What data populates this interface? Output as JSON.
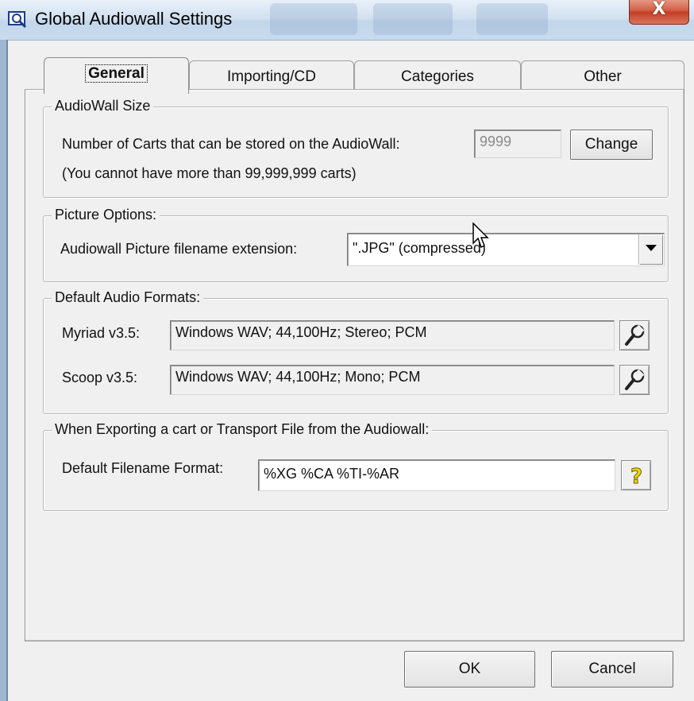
{
  "window": {
    "title": "Global Audiowall Settings",
    "close_glyph": "X"
  },
  "tabs": [
    {
      "label": "General",
      "active": true
    },
    {
      "label": "Importing/CD",
      "active": false
    },
    {
      "label": "Categories",
      "active": false
    },
    {
      "label": "Other",
      "active": false
    }
  ],
  "audiowall_size": {
    "legend": "AudioWall Size",
    "label": "Number of Carts that can be stored on the AudioWall:",
    "value": "9999",
    "change_button": "Change",
    "note": "(You cannot have more than 99,999,999 carts)"
  },
  "picture_options": {
    "legend": "Picture Options:",
    "label": "Audiowall Picture filename extension:",
    "selected": "\".JPG\" (compressed)"
  },
  "audio_formats": {
    "legend": "Default Audio Formats:",
    "myriad_label": "Myriad v3.5:",
    "myriad_value": "Windows WAV; 44,100Hz; Stereo; PCM",
    "scoop_label": "Scoop v3.5:",
    "scoop_value": "Windows WAV; 44,100Hz; Mono; PCM"
  },
  "export": {
    "legend": "When Exporting a cart or Transport File from the Audiowall:",
    "label": "Default Filename Format:",
    "value": "%XG %CA %TI-%AR",
    "help_glyph": "?"
  },
  "footer": {
    "ok": "OK",
    "cancel": "Cancel"
  },
  "icons": {
    "app": "audiowall-magnifier-icon",
    "format_settings": "wrench-icon",
    "help": "question-mark-icon",
    "dropdown": "down-triangle-icon"
  },
  "colors": {
    "help_yellow": "#f5d800",
    "title_bar": "#d2e1f0",
    "close_red": "#c23f25"
  }
}
